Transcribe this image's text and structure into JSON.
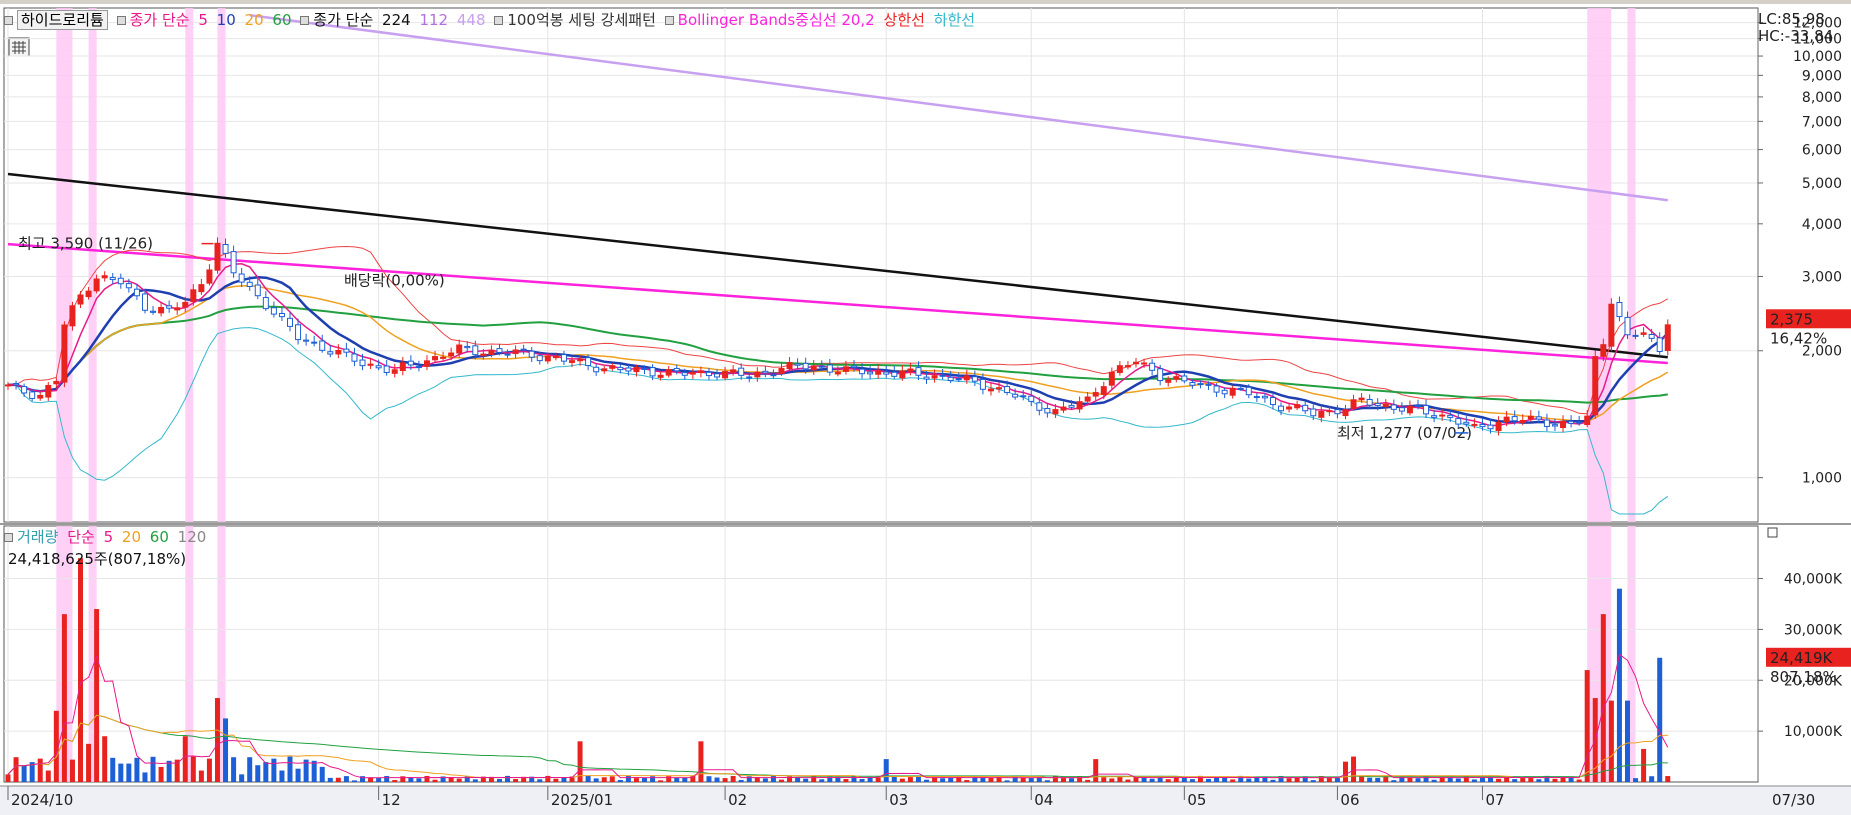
{
  "stock_name": "하이드로리튬",
  "price_legend": {
    "close_ma_label": "종가 단순",
    "ma5": "5",
    "ma10": "10",
    "ma20": "20",
    "ma60": "60",
    "close_ma2_label": "종가 단순",
    "ma224": "224",
    "ma112": "112",
    "ma448": "448",
    "pattern": "100억봉 세팅 강세패턴",
    "bollinger": "Bollinger Bands중심선 20,2",
    "upper": "상한선",
    "lower": "하한선"
  },
  "volume_legend": {
    "label": "거래량",
    "ma_label": "단순",
    "ma5": "5",
    "ma20": "20",
    "ma60": "60",
    "ma120": "120",
    "current": "24,418,625주(807,18%)"
  },
  "right_labels": {
    "lc": "LC:85,98",
    "hc": "HC:-33,84",
    "price_box": "2,375",
    "price_pct": "16,42%",
    "vol_box": "24,419K",
    "vol_pct": "807,18%",
    "date_label": "07/30"
  },
  "annotations": {
    "high": "최고 3,590 (11/26)",
    "low": "최저 1,277 (07/02)",
    "dividend": "배당락(0,00%)"
  },
  "colors": {
    "up": "#e8231f",
    "down": "#1c5fd6",
    "ma5": "#e8198b",
    "ma10": "#1e3fb0",
    "ma20": "#f0a020",
    "ma60": "#22a040",
    "ma224": "#111111",
    "ma448": "#c8a0f0",
    "bb_mid": "#ff22dd",
    "bb_upper": "#ee4444",
    "bb_lower": "#33b8cc",
    "highlight": "#ffc8f4"
  },
  "chart_data": [
    {
      "type": "candlestick",
      "title": "하이드로리튬",
      "y_scale": "log",
      "y_ticks": [
        "1,000",
        "2,000",
        "3,000",
        "4,000",
        "5,000",
        "6,000",
        "7,000",
        "8,000",
        "9,000",
        "10,000",
        "11,000",
        "12,000"
      ],
      "x_ticks": [
        "2024/10",
        "12",
        "2025/01",
        "02",
        "03",
        "04",
        "05",
        "06",
        "07"
      ],
      "last_close": 2375,
      "change_pct": 16.42,
      "high": {
        "value": 3590,
        "date": "11/26"
      },
      "low": {
        "value": 1277,
        "date": "07/02"
      },
      "ma224_range": [
        5250,
        1930
      ],
      "ma448_range": [
        12500,
        4550
      ],
      "highlight_periods": [
        "2024/10 early",
        "2024/10 mid",
        "2024/11 late",
        "2024/11 end",
        "2025/07 late",
        "2025/07 end"
      ]
    },
    {
      "type": "bar",
      "title": "거래량",
      "y_ticks": [
        "10,000K",
        "20,000K",
        "30,000K",
        "40,000K"
      ],
      "last_value_k": 24419,
      "change_pct": 807.18,
      "peaks_k": [
        {
          "label": "2024/10",
          "value": 44000
        },
        {
          "label": "2024/10",
          "value": 34000
        },
        {
          "label": "2024/11",
          "value": 16000
        },
        {
          "label": "2025/07",
          "value": 33000
        },
        {
          "label": "2025/07",
          "value": 38000
        },
        {
          "label": "2025/07",
          "value": 24419
        }
      ]
    }
  ]
}
